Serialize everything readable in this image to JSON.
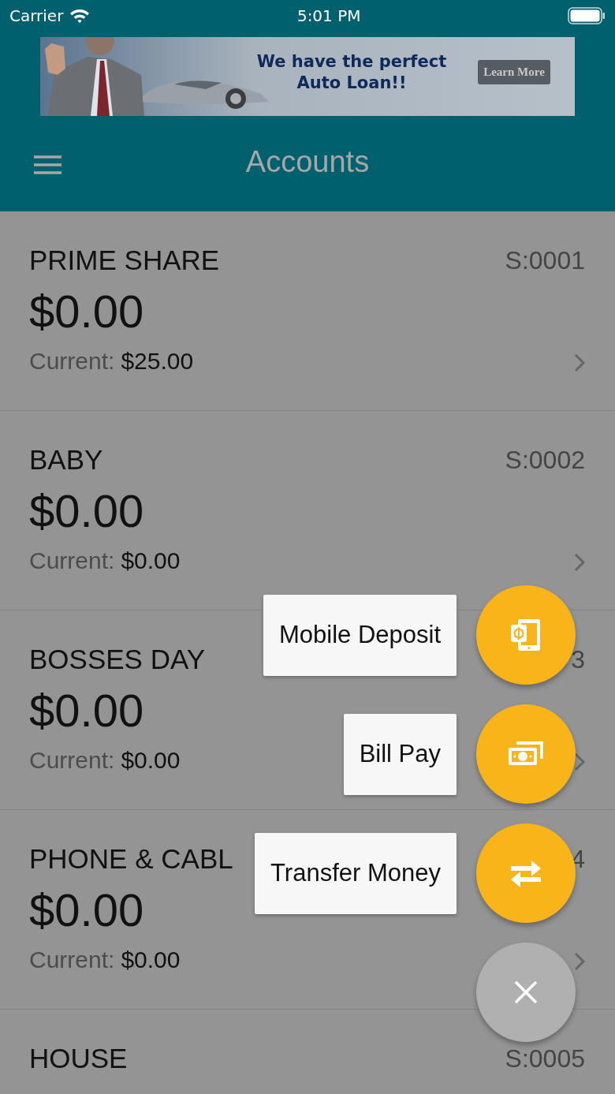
{
  "status_bar": {
    "carrier": "Carrier",
    "time": "5:01 PM"
  },
  "banner": {
    "headline": "We have the perfect Auto Loan!!",
    "button": "Learn More"
  },
  "header": {
    "title": "Accounts"
  },
  "accounts": [
    {
      "name": "PRIME SHARE",
      "number": "S:0001",
      "balance": "$0.00",
      "current_label": "Current:",
      "current": "$25.00"
    },
    {
      "name": "BABY",
      "number": "S:0002",
      "balance": "$0.00",
      "current_label": "Current:",
      "current": "$0.00"
    },
    {
      "name": "BOSSES DAY",
      "number": "3",
      "balance": "$0.00",
      "current_label": "Current:",
      "current": "$0.00"
    },
    {
      "name": "PHONE & CABL",
      "number": "4",
      "balance": "$0.00",
      "current_label": "Current:",
      "current": "$0.00"
    },
    {
      "name": "HOUSE",
      "number": "S:0005"
    }
  ],
  "fab_menu": {
    "actions": [
      {
        "label": "Mobile Deposit",
        "kind": "deposit"
      },
      {
        "label": "Bill Pay",
        "kind": "bills"
      },
      {
        "label": "Transfer Money",
        "kind": "transfer"
      }
    ]
  }
}
